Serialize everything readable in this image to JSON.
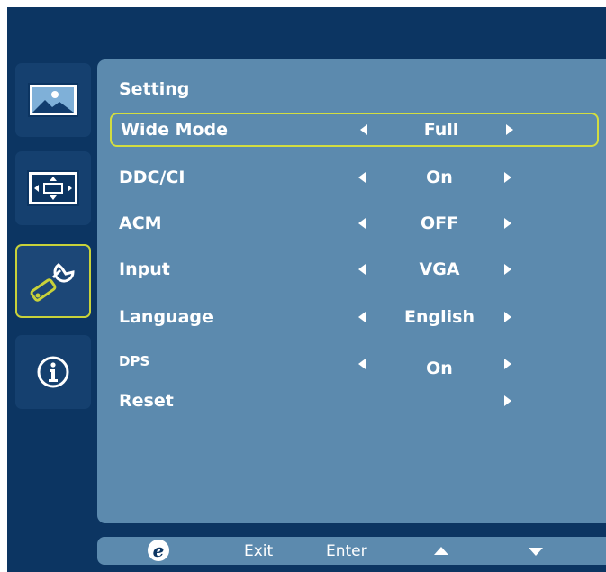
{
  "colors": {
    "background": "#0c3562",
    "panel": "#5c8aae",
    "highlight_border": "#d3dd40",
    "text": "#ffffff"
  },
  "sidebar": {
    "items": [
      {
        "icon": "picture-icon",
        "active": false
      },
      {
        "icon": "display-position-icon",
        "active": false
      },
      {
        "icon": "setting-wrench-icon",
        "active": true
      },
      {
        "icon": "info-icon",
        "active": false
      }
    ]
  },
  "panel": {
    "title": "Setting",
    "rows": [
      {
        "label": "Wide Mode",
        "value": "Full",
        "selected": true
      },
      {
        "label": "DDC/CI",
        "value": "On"
      },
      {
        "label": "ACM",
        "value": "OFF"
      },
      {
        "label": "Input",
        "value": "VGA"
      },
      {
        "label": "Language",
        "value": "English"
      },
      {
        "label": "DPS",
        "value": "On"
      },
      {
        "label": "Reset",
        "value": ""
      }
    ]
  },
  "footer": {
    "exit_label": "Exit",
    "enter_label": "Enter",
    "icons": [
      "e-logo-icon",
      "up-arrow-icon",
      "down-arrow-icon"
    ]
  }
}
